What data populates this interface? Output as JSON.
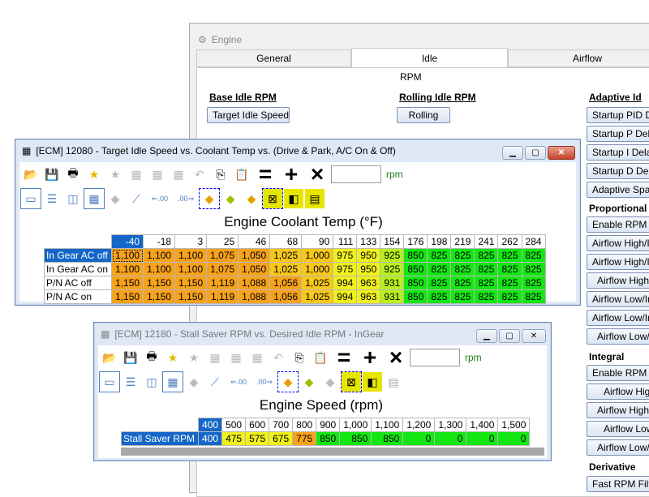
{
  "engine": {
    "title": "Engine",
    "tabs": [
      {
        "label": "General"
      },
      {
        "label": "Idle"
      },
      {
        "label": "Airflow"
      }
    ],
    "rpm_label": "RPM",
    "base_idle": {
      "heading": "Base Idle RPM",
      "button": "Target Idle Speed"
    },
    "rolling_idle": {
      "heading": "Rolling Idle RPM",
      "button": "Rolling"
    },
    "adaptive": {
      "heading": "Adaptive Id",
      "buttons": [
        "Startup PID De",
        "Startup P Delay",
        "Startup I Delay",
        "Startup D Delay",
        "Adaptive Spark"
      ],
      "proportional": {
        "heading": "Proportional",
        "buttons": [
          "Enable RPM Er",
          "Airflow High/InG",
          "Airflow High/InG",
          "Airflow High/P",
          "Airflow Low/InG",
          "Airflow Low/InG",
          "Airflow Low/P"
        ]
      },
      "integral": {
        "heading": "Integral",
        "buttons": [
          "Enable RPM Er",
          "Airflow High/",
          "Airflow High/P",
          "Airflow Low/",
          "Airflow Low/P"
        ]
      },
      "derivative": {
        "heading": "Derivative",
        "buttons": [
          "Fast RPM Filter"
        ]
      }
    }
  },
  "win1": {
    "title": "[ECM] 12080 - Target Idle Speed vs. Coolant Temp vs. (Drive & Park, A/C On & Off)",
    "unit": "rpm",
    "axis_title": "Engine Coolant Temp (°F)",
    "columns": [
      "-40",
      "-18",
      "3",
      "25",
      "46",
      "68",
      "90",
      "111",
      "133",
      "154",
      "176",
      "198",
      "219",
      "241",
      "262",
      "284"
    ],
    "rows": [
      {
        "label": "In Gear AC off",
        "values": [
          "1,100",
          "1,100",
          "1,100",
          "1,075",
          "1,050",
          "1,025",
          "1,000",
          "975",
          "950",
          "925",
          "850",
          "825",
          "825",
          "825",
          "825",
          "825"
        ]
      },
      {
        "label": "In Gear AC on",
        "values": [
          "1,100",
          "1,100",
          "1,100",
          "1,075",
          "1,050",
          "1,025",
          "1,000",
          "975",
          "950",
          "925",
          "850",
          "825",
          "825",
          "825",
          "825",
          "825"
        ]
      },
      {
        "label": "P/N AC off",
        "values": [
          "1,150",
          "1,150",
          "1,150",
          "1,119",
          "1,088",
          "1,056",
          "1,025",
          "994",
          "963",
          "931",
          "850",
          "825",
          "825",
          "825",
          "825",
          "825"
        ]
      },
      {
        "label": "P/N AC on",
        "values": [
          "1,150",
          "1,150",
          "1,150",
          "1,119",
          "1,088",
          "1,056",
          "1,025",
          "994",
          "963",
          "931",
          "850",
          "825",
          "825",
          "825",
          "825",
          "825"
        ]
      }
    ]
  },
  "win2": {
    "title": "[ECM] 12180 - Stall Saver RPM vs. Desired Idle RPM - InGear",
    "unit": "rpm",
    "axis_title": "Engine Speed (rpm)",
    "columns": [
      "400",
      "500",
      "600",
      "700",
      "800",
      "900",
      "1,000",
      "1,100",
      "1,200",
      "1,300",
      "1,400",
      "1,500"
    ],
    "rows": [
      {
        "label": "Stall Saver RPM",
        "values": [
          "400",
          "475",
          "575",
          "675",
          "775",
          "850",
          "850",
          "850",
          "0",
          "0",
          "0",
          "0"
        ]
      }
    ]
  },
  "colors": {
    "selection": "#1466c7",
    "orange": "#f7a21b",
    "gold": "#f7c81b",
    "yellow": "#f0f01c",
    "lime": "#b8f01c",
    "green": "#14e614"
  },
  "toolbar_operators": [
    "=",
    "+",
    "×"
  ],
  "toolbar_labels": {
    "left": "⇐.00",
    "left2": ".00",
    "right": ".00",
    "right2": "⇒.00"
  }
}
